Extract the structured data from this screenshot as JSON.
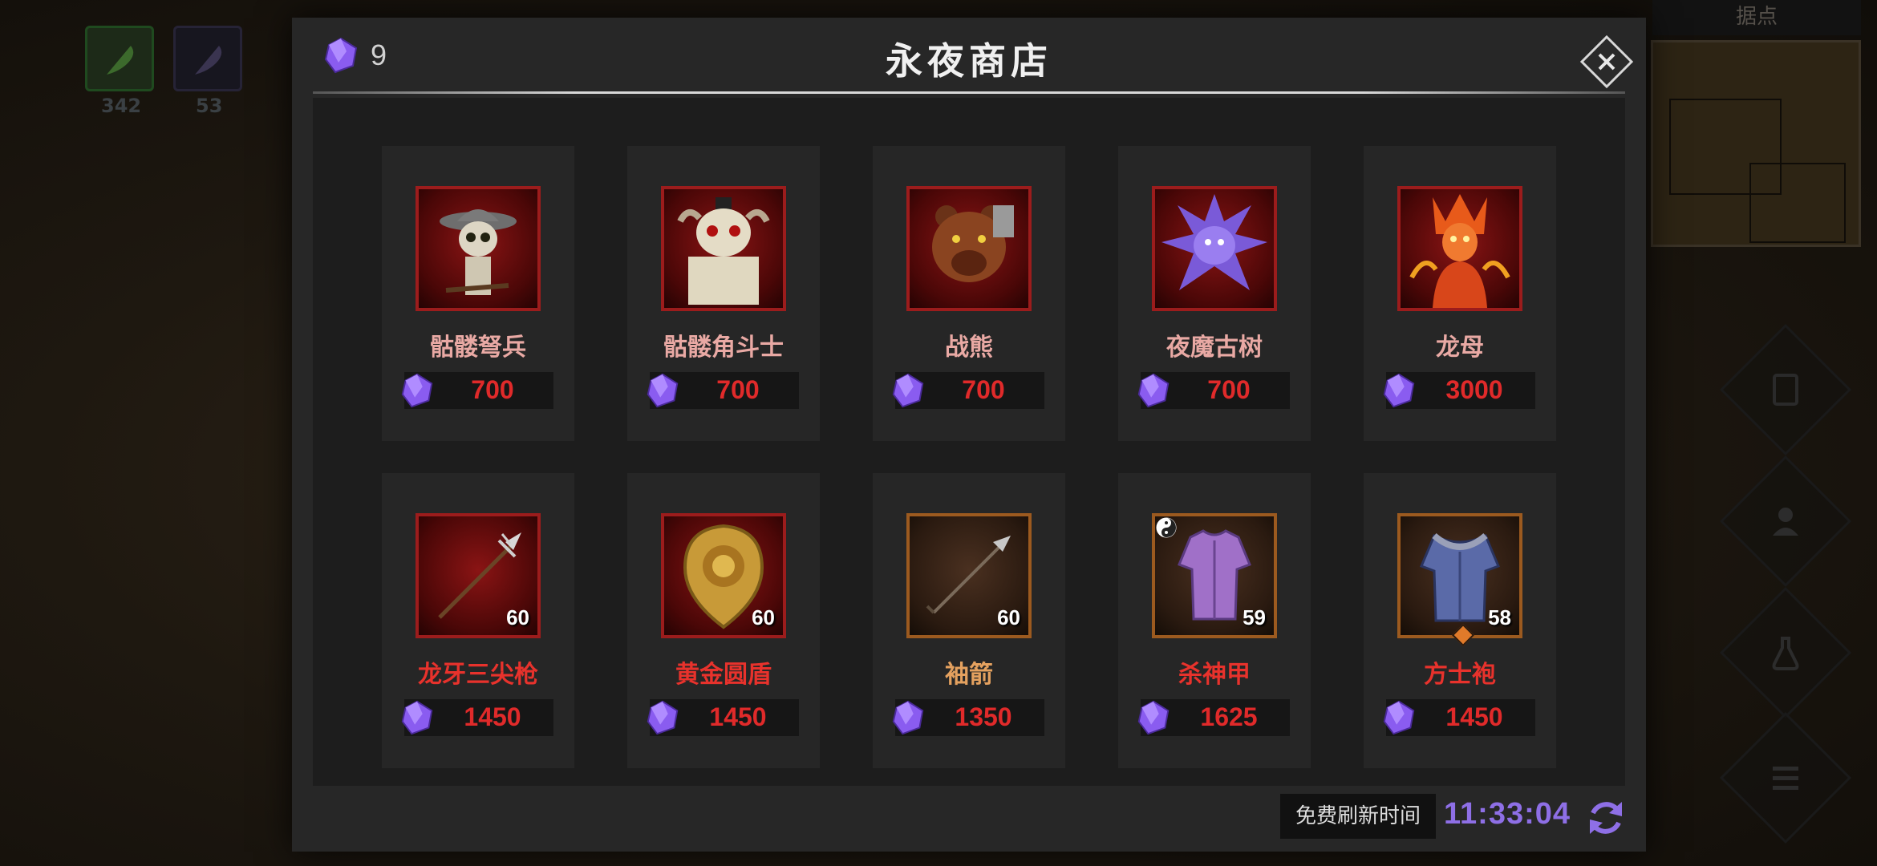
{
  "background": {
    "resources": [
      {
        "icon": "green-feather-icon",
        "value": "342"
      },
      {
        "icon": "purple-feather-icon",
        "value": "53"
      }
    ],
    "minimap_title": "据点"
  },
  "shop": {
    "currency_icon": "purple-gem-icon",
    "gem_balance": "9",
    "title": "永夜商店",
    "close_icon": "close-icon",
    "items": [
      {
        "name": "骷髅弩兵",
        "price": "700",
        "frame": "red",
        "name_color": "pink",
        "icon": "skeleton-crossbowman-portrait"
      },
      {
        "name": "骷髅角斗士",
        "price": "700",
        "frame": "red",
        "name_color": "pink",
        "icon": "skeleton-gladiator-portrait"
      },
      {
        "name": "战熊",
        "price": "700",
        "frame": "red",
        "name_color": "pink",
        "icon": "war-bear-portrait"
      },
      {
        "name": "夜魔古树",
        "price": "700",
        "frame": "red",
        "name_color": "pink",
        "icon": "night-demon-ancient-tree-portrait"
      },
      {
        "name": "龙母",
        "price": "3000",
        "frame": "red",
        "name_color": "pink",
        "icon": "dragon-mother-portrait"
      },
      {
        "name": "龙牙三尖枪",
        "price": "1450",
        "level": "60",
        "frame": "red",
        "name_color": "red",
        "icon": "trident-spear-icon"
      },
      {
        "name": "黄金圆盾",
        "price": "1450",
        "level": "60",
        "frame": "red",
        "name_color": "red",
        "icon": "golden-round-shield-icon"
      },
      {
        "name": "袖箭",
        "price": "1350",
        "level": "60",
        "frame": "brown",
        "name_color": "orange",
        "icon": "sleeve-arrow-icon"
      },
      {
        "name": "杀神甲",
        "price": "1625",
        "level": "59",
        "frame": "brown",
        "name_color": "red",
        "icon": "purple-armor-icon",
        "badge": "yin-yang-icon"
      },
      {
        "name": "方士袍",
        "price": "1450",
        "level": "58",
        "frame": "brown",
        "name_color": "red",
        "icon": "blue-robe-icon",
        "badge": "orange-diamond-icon"
      }
    ],
    "refresh": {
      "label": "免费刷新时间",
      "time": "11:33:04",
      "icon": "refresh-icon"
    }
  },
  "side_buttons": [
    "quest-scroll-icon",
    "friends-icon",
    "potion-icon",
    "menu-list-icon"
  ],
  "colors": {
    "price": "#e02a2a",
    "timer": "#8e6fe6",
    "gem": "#8a5cf0",
    "rare_frame": "#9c1c1c",
    "epic_frame": "#9c5a1f"
  }
}
